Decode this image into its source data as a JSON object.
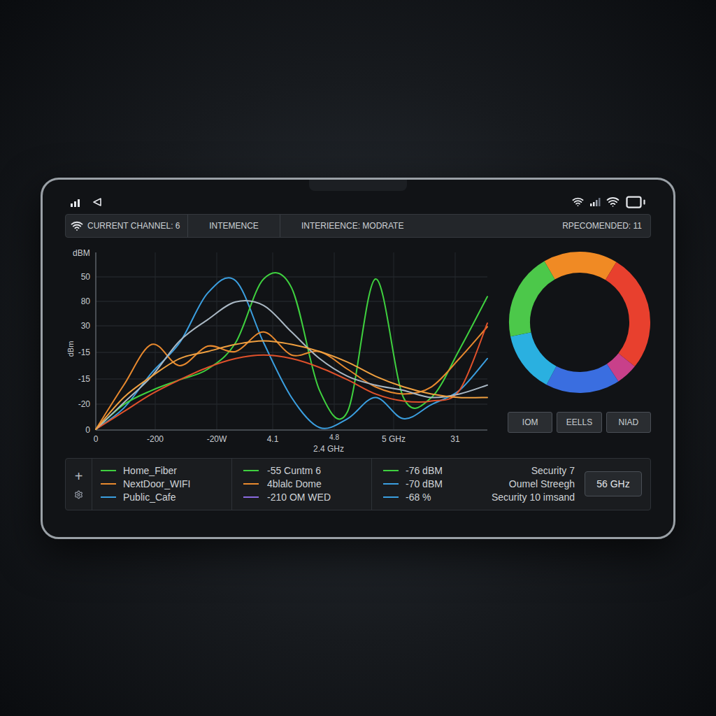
{
  "header": {
    "channel": "CURRENT CHANNEL: 6",
    "items": [
      "INTEMENCE",
      "INTERIEENCE: MODRATE"
    ],
    "recommended": "RPECOMENDED: 11"
  },
  "chart": {
    "y_title": "dBM",
    "y_axis_label": "dBm",
    "y_ticks": [
      "50",
      "80",
      "30",
      "-15",
      "-15",
      "-20",
      "0"
    ],
    "x_ticks": [
      "0",
      "-200",
      "-20W",
      "4.1",
      "4.8",
      "5 GHz",
      "31"
    ],
    "x_label": "2.4 GHz",
    "series": [
      {
        "color": "#3b9fe0",
        "values": [
          0,
          12,
          32,
          49,
          77,
          84,
          49,
          18,
          1,
          6,
          18,
          6,
          14,
          22,
          40
        ]
      },
      {
        "color": "#3fd13f",
        "values": [
          0,
          14,
          22,
          28,
          34,
          49,
          85,
          80,
          22,
          10,
          85,
          18,
          18,
          45,
          75
        ]
      },
      {
        "color": "#e8892e",
        "values": [
          0,
          25,
          48,
          36,
          47,
          44,
          55,
          42,
          44,
          34,
          24,
          20,
          24,
          40,
          58
        ]
      },
      {
        "color": "#e0512b",
        "values": [
          0,
          10,
          20,
          28,
          35,
          40,
          42,
          40,
          35,
          28,
          20,
          16,
          16,
          22,
          60
        ]
      },
      {
        "color": "#aab8c4",
        "values": [
          0,
          15,
          30,
          50,
          62,
          72,
          70,
          55,
          40,
          30,
          25,
          22,
          18,
          20,
          25
        ]
      },
      {
        "color": "#f0a040",
        "values": [
          0,
          18,
          30,
          40,
          44,
          48,
          50,
          48,
          44,
          38,
          30,
          24,
          20,
          18,
          18
        ]
      }
    ]
  },
  "donut": {
    "segments": [
      {
        "color": "#f08a24",
        "level": 0.17
      },
      {
        "color": "#e8402e",
        "level": 0.27
      },
      {
        "color": "#c8408a",
        "level": 0.05
      },
      {
        "color": "#3a6ee0",
        "level": 0.17
      },
      {
        "color": "#2ab0e0",
        "level": 0.14
      },
      {
        "color": "#4cc84a",
        "level": 0.2
      }
    ]
  },
  "buttons": [
    "IOM",
    "EELLS",
    "NIAD"
  ],
  "legend": {
    "add": "+",
    "networks": [
      {
        "name": "Home_Fiber",
        "color": "#3fd13f"
      },
      {
        "name": "NextDoor_WIFI",
        "color": "#e8892e"
      },
      {
        "name": "Public_Cafe",
        "color": "#3b9fe0"
      }
    ],
    "details": [
      {
        "text": "-55 Cuntm 6",
        "color": "#3fd13f"
      },
      {
        "text": "4blalc Dome",
        "color": "#e8892e"
      },
      {
        "text": "-210 OM WED",
        "color": "#8a6ae0"
      }
    ],
    "readings": [
      {
        "text": "-76 dBM",
        "color": "#3fd13f"
      },
      {
        "text": "-70 dBM",
        "color": "#3b9fe0"
      },
      {
        "text": "-68 %",
        "color": "#3b9fe0"
      }
    ],
    "security": [
      "Security 7",
      "Oumel Streegh",
      "Security 10 imsand"
    ],
    "band_button": "56 GHz"
  }
}
